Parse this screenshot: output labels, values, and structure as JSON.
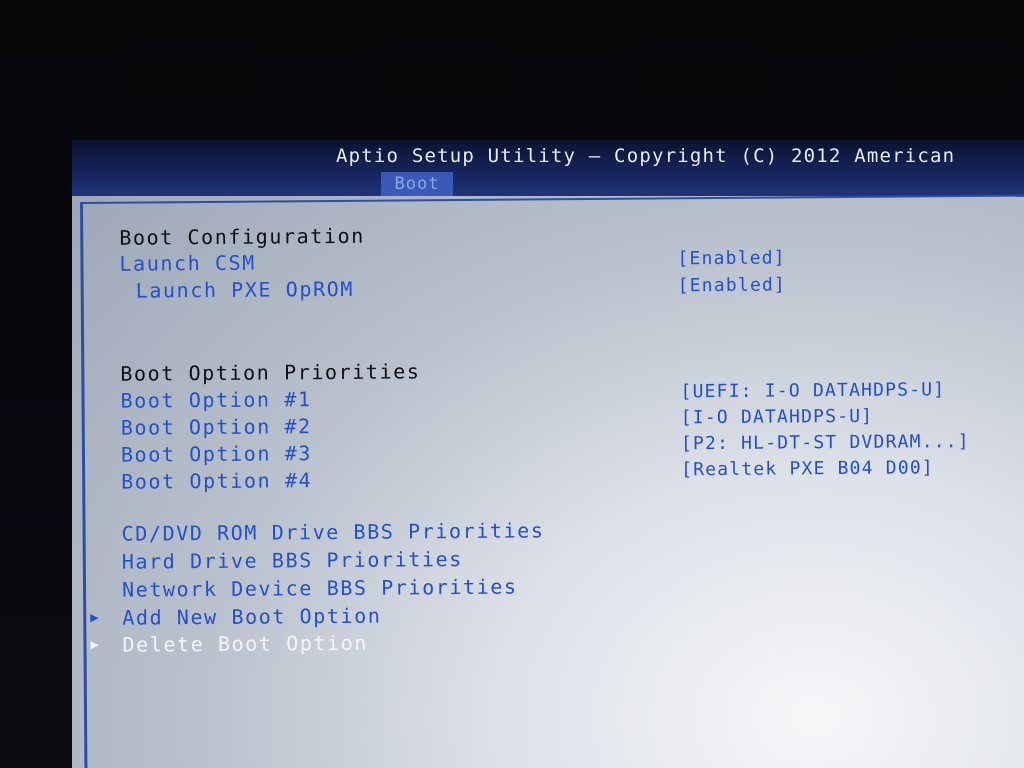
{
  "header": {
    "title": "Aptio Setup Utility – Copyright (C) 2012 American",
    "active_tab": "Boot"
  },
  "boot_configuration": {
    "heading": "Boot Configuration",
    "launch_csm": {
      "label": "Launch CSM",
      "value": "[Enabled]"
    },
    "launch_pxe_oprom": {
      "label": "Launch PXE OpROM",
      "value": "[Enabled]"
    }
  },
  "boot_priorities": {
    "heading": "Boot Option Priorities",
    "options": [
      {
        "label": "Boot Option #1",
        "value": "[UEFI: I-O DATAHDPS-U]"
      },
      {
        "label": "Boot Option #2",
        "value": "[I-O DATAHDPS-U]"
      },
      {
        "label": "Boot Option #3",
        "value": "[P2: HL-DT-ST DVDRAM...]"
      },
      {
        "label": "Boot Option #4",
        "value": "[Realtek PXE B04 D00]"
      }
    ]
  },
  "submenus": {
    "cd_dvd": "CD/DVD ROM Drive BBS Priorities",
    "hard_drive": "Hard Drive BBS Priorities",
    "network": "Network Device BBS Priorities",
    "add_boot_option": "Add New Boot Option",
    "delete_boot_option": "Delete Boot Option"
  },
  "icons": {
    "submenu_arrow": "triangle-right-icon"
  },
  "colors": {
    "header_bg": "#16245a",
    "tab_bg": "#3a5ab8",
    "item_text": "#2250c8",
    "heading_text": "#0e0f14",
    "selected_text": "#f4f5f8"
  }
}
